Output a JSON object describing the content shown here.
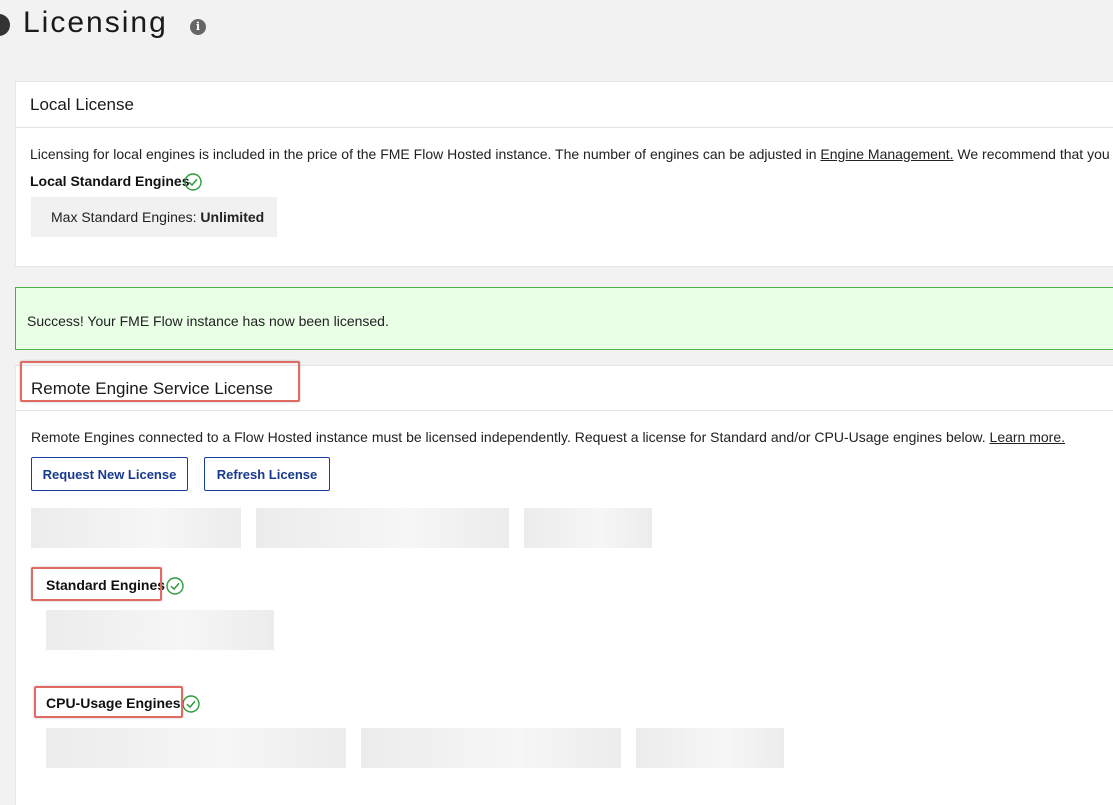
{
  "header": {
    "title": "Licensing",
    "info_icon": "info-icon"
  },
  "local_license": {
    "title": "Local License",
    "description": "Licensing for local engines is included in the price of the FME Flow Hosted instance. The number of engines can be adjusted in ",
    "link_text": "Engine Management.",
    "description_tail": " We recommend that you s",
    "engines_label": "Local Standard Engines",
    "max_label": "Max Standard Engines: ",
    "max_value": "Unlimited"
  },
  "success_message": "Success! Your FME Flow instance has now been licensed.",
  "remote_license": {
    "title": "Remote Engine Service License",
    "description": "Remote Engines connected to a Flow Hosted instance must be licensed independently. Request a license for Standard and/or CPU-Usage engines below. ",
    "learn_more": "Learn more.",
    "request_button": "Request New License",
    "refresh_button": "Refresh License",
    "standard_label": "Standard Engines",
    "cpu_label": "CPU-Usage Engines"
  },
  "colors": {
    "accent": "#17398f",
    "success_bg": "#e9ffe6",
    "success_border": "#4cae48",
    "check_green": "#2e9b3a",
    "highlight_red": "#e06b62"
  }
}
